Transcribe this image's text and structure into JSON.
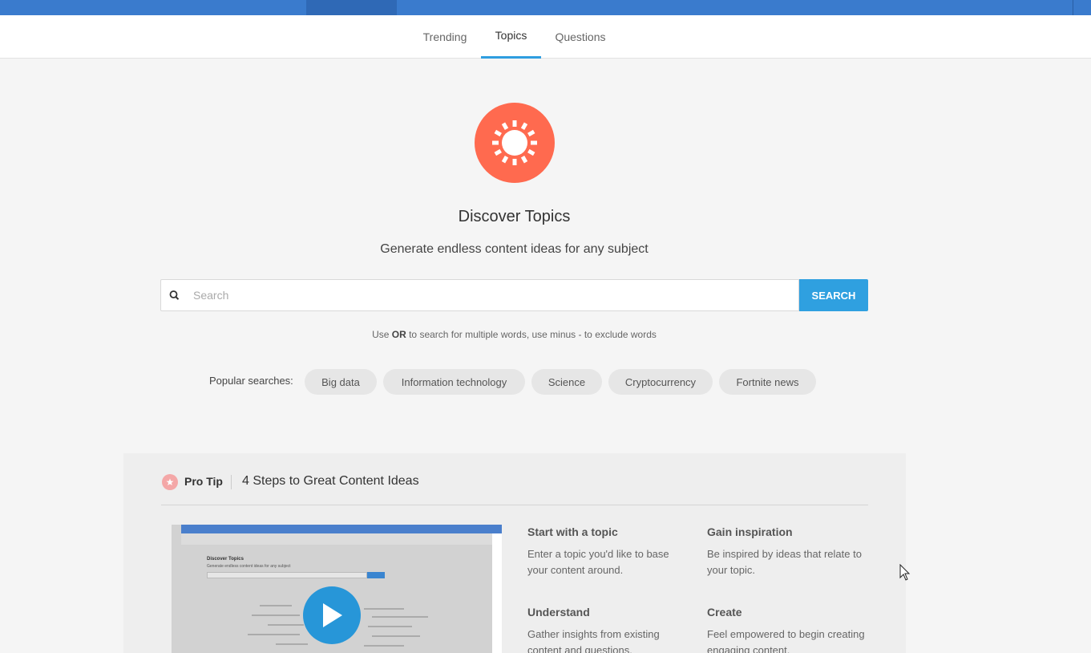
{
  "nav": {
    "tabs": [
      {
        "label": "Trending",
        "active": false
      },
      {
        "label": "Topics",
        "active": true
      },
      {
        "label": "Questions",
        "active": false
      }
    ]
  },
  "hero": {
    "icon": "sun-icon",
    "title": "Discover Topics",
    "subtitle": "Generate endless content ideas for any subject"
  },
  "search": {
    "placeholder": "Search",
    "value": "",
    "button_label": "SEARCH",
    "hint_pre": "Use ",
    "hint_bold": "OR",
    "hint_post": " to search for multiple words, use minus - to exclude words"
  },
  "popular": {
    "label": "Popular searches:",
    "items": [
      "Big data",
      "Information technology",
      "Science",
      "Cryptocurrency",
      "Fortnite news"
    ]
  },
  "protip": {
    "badge_label": "Pro Tip",
    "title": "4 Steps to Great Content Ideas",
    "video": {
      "thumb_title": "Discover Topics",
      "thumb_subtitle": "Generate endless content ideas for any subject"
    },
    "steps": [
      {
        "heading": "Start with a topic",
        "text": "Enter a topic you'd like to base your content around."
      },
      {
        "heading": "Gain inspiration",
        "text": "Be inspired by ideas that relate to your topic."
      },
      {
        "heading": "Understand",
        "text": "Gather insights from existing content and questions."
      },
      {
        "heading": "Create",
        "text": "Feel empowered to begin creating engaging content."
      }
    ]
  },
  "colors": {
    "topbar": "#3a7bcd",
    "accent": "#2fa0e0",
    "hero_icon_bg": "#ff6a4f",
    "page_bg": "#f5f5f5"
  }
}
